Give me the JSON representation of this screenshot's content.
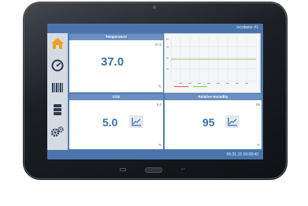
{
  "header": {
    "title": "Incubator #1"
  },
  "footer": {
    "datetime": "05.31.15 16:08:40"
  },
  "sidebar": {
    "items": [
      {
        "icon": "home-icon",
        "active": true
      },
      {
        "icon": "gauge-icon",
        "active": false
      },
      {
        "icon": "barcode-icon",
        "active": false
      },
      {
        "icon": "database-icon",
        "active": false
      },
      {
        "icon": "gears-icon",
        "active": false
      }
    ]
  },
  "panels": {
    "temperature": {
      "title": "Temperature",
      "value": "37.0",
      "setpoint": "37.0",
      "unit": "°C"
    },
    "co2": {
      "title": "CO2",
      "value": "5.0",
      "setpoint": "5.0",
      "unit": "%"
    },
    "humidity": {
      "title": "Relative Humidity",
      "value": "95",
      "setpoint": "95",
      "unit": "%"
    }
  },
  "colors": {
    "screen": "#4f7bb0",
    "accent": "#3c6ea6",
    "home_icon": "#f0a020",
    "line_green": "#8fd36a",
    "line_red": "#e06a5a"
  }
}
